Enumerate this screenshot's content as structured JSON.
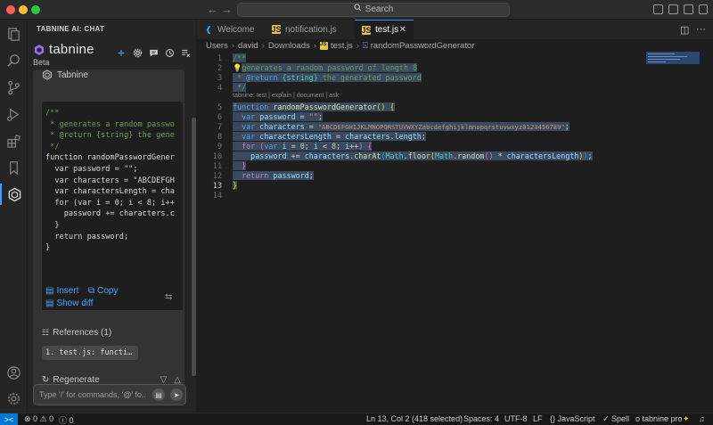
{
  "titlebar": {
    "search_label": "Search",
    "back_arrow": "←",
    "forward_arrow": "→"
  },
  "panel": {
    "title": "TABNINE AI: CHAT",
    "logo_text": "tabnine",
    "beta_label": "Beta",
    "actions": [
      "+",
      "gear-icon",
      "chat-icon",
      "history-icon",
      "list-icon"
    ]
  },
  "chat": {
    "author": "Tabnine",
    "code_lines": [
      "/**",
      " * generates a random passwo",
      " * @return {string} the gene",
      " */",
      "function randomPasswordGener",
      "  var password = \"\";",
      "  var characters = \"ABCDEFGH",
      "  var charactersLength = cha",
      "  for (var i = 0; i < 8; i++",
      "    password += characters.c",
      "  }",
      "  return password;",
      "}"
    ],
    "insert_label": "Insert",
    "copy_label": "Copy",
    "show_diff_label": "Show diff",
    "references_label": "References (1)",
    "reference_chip": "1. test.js: functi…",
    "regenerate_label": "Regenerate",
    "input_placeholder": "Type '/' for commands, '@' fo..."
  },
  "editor": {
    "tabs": [
      {
        "label": "Welcome",
        "active": false
      },
      {
        "label": "notification.js",
        "active": false
      },
      {
        "label": "test.js",
        "active": true
      }
    ],
    "breadcrumb": [
      "Users",
      "david",
      "Downloads",
      "test.js",
      "randomPasswordGenerator"
    ],
    "line_numbers": [
      "1",
      "2",
      "3",
      "4",
      "5",
      "6",
      "7",
      "8",
      "9",
      "10",
      "11",
      "12",
      "13",
      "14"
    ],
    "current_line": "13",
    "codelens": "tabnine: test | explain | document | ask"
  },
  "statusbar": {
    "remote_icon": "><",
    "problems": "⊗ 0 ⚠ 0",
    "info": "ⓘ 0",
    "position": "Ln 13, Col 2 (418 selected)",
    "spaces": "Spaces: 4",
    "encoding": "UTF-8",
    "eol": "LF",
    "language": "{} JavaScript",
    "spell": "✓ Spell",
    "tabnine": "o tabnine pro"
  },
  "colors": {
    "accent": "#3b9cff",
    "selection": "#394a5e",
    "link": "#4aa3ff"
  }
}
